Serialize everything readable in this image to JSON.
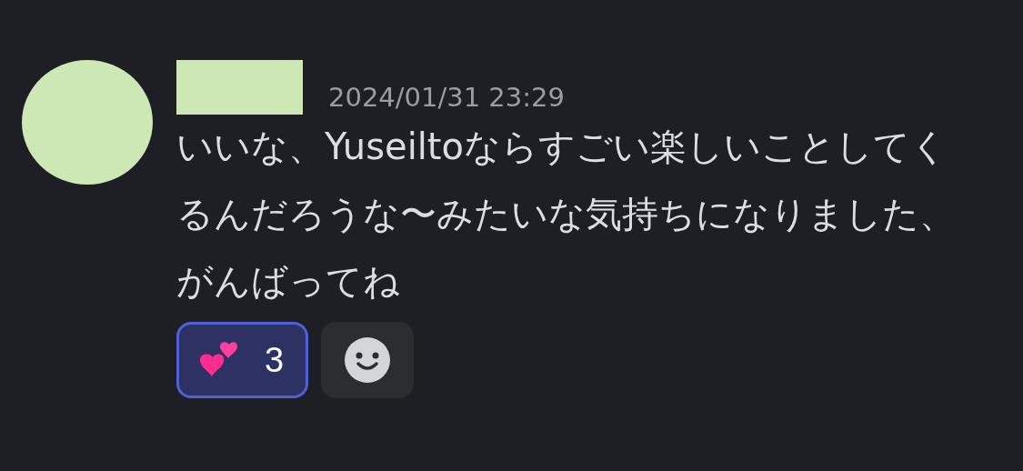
{
  "message": {
    "timestamp": "2024/01/31 23:29",
    "text": "いいな、Yuseiltoならすごい楽しいことしてくるんだろうな〜みたいな気持ちになりました、がんばってね",
    "reactions": [
      {
        "count": "3",
        "selected": true
      }
    ]
  }
}
